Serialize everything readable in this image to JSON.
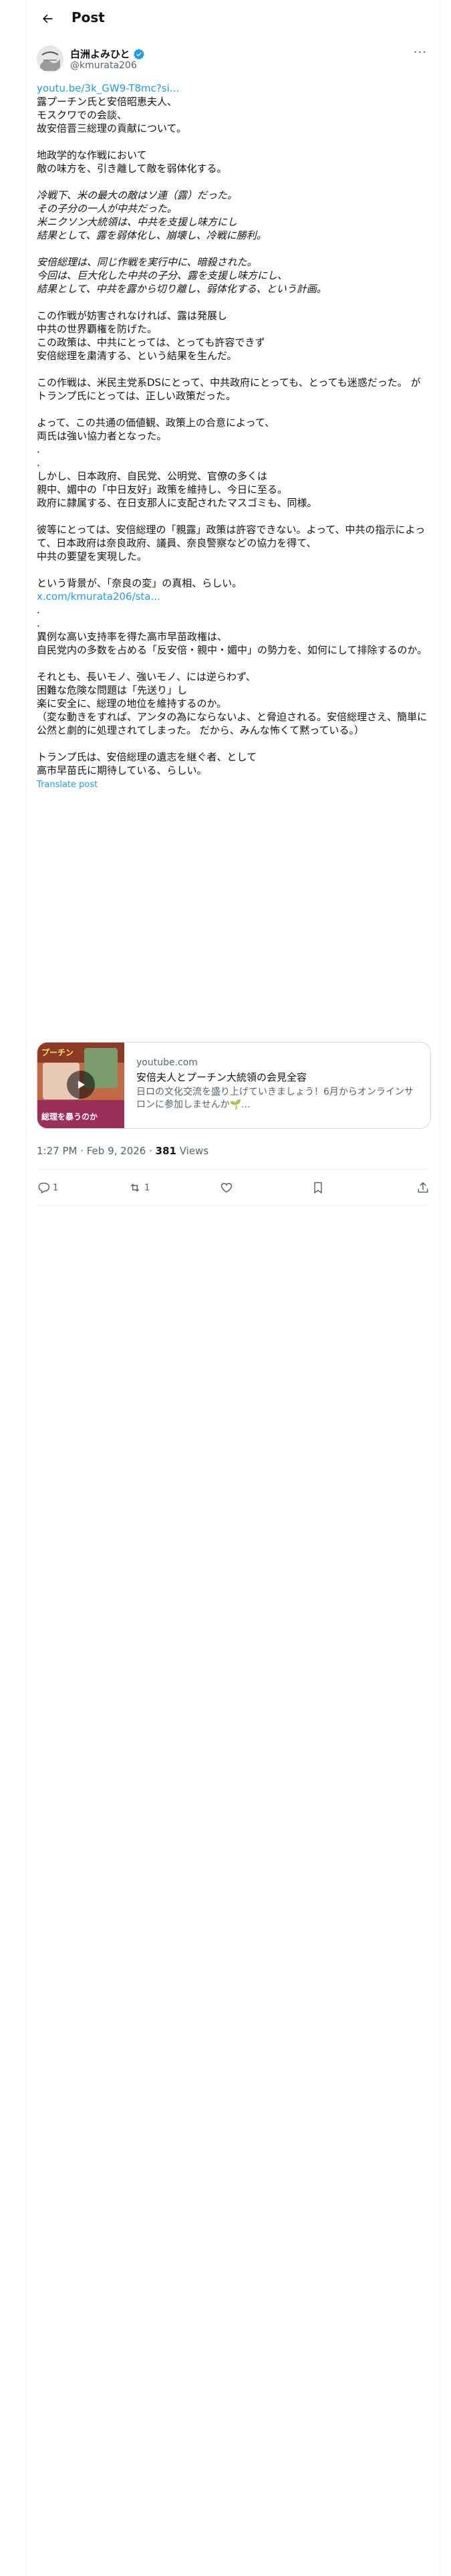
{
  "header": {
    "title": "Post"
  },
  "author": {
    "name": "白洲よみひと",
    "handle": "@kmurata206"
  },
  "post": {
    "lines": [
      {
        "t": "youtu.be/3k_GW9-T8mc?si...",
        "s": "link"
      },
      {
        "t": "露プーチン氏と安倍昭恵夫人、",
        "s": ""
      },
      {
        "t": "モスクワでの会談、",
        "s": ""
      },
      {
        "t": "故安倍晋三総理の貢献について。",
        "s": ""
      },
      {
        "t": "",
        "s": ""
      },
      {
        "t": "地政学的な作戦において",
        "s": ""
      },
      {
        "t": "敵の味方を、引き離して敵を弱体化する。",
        "s": ""
      },
      {
        "t": "",
        "s": ""
      },
      {
        "t": "冷戦下、米の最大の敵はソ連（露）だった。",
        "s": "it"
      },
      {
        "t": "その子分の一人が中共だった。",
        "s": "it"
      },
      {
        "t": "米ニクソン大統領は、中共を支援し味方にし",
        "s": "it"
      },
      {
        "t": "結果として、露を弱体化し、崩壊し、冷戦に勝利。",
        "s": "it"
      },
      {
        "t": "",
        "s": ""
      },
      {
        "t": "安倍総理は、同じ作戦を実行中に、暗殺された。",
        "s": "it"
      },
      {
        "t": "今回は、巨大化した中共の子分、露を支援し味方にし、",
        "s": "it"
      },
      {
        "t": "結果として、中共を露から切り離し、弱体化する、という計画。",
        "s": "it"
      },
      {
        "t": "",
        "s": ""
      },
      {
        "t": "この作戦が妨害されなければ、露は発展し",
        "s": ""
      },
      {
        "t": "中共の世界覇権を防げた。",
        "s": ""
      },
      {
        "t": "この政策は、中共にとっては、とっても許容できず",
        "s": ""
      },
      {
        "t": "安倍総理を粛清する、という結果を生んだ。",
        "s": ""
      },
      {
        "t": "",
        "s": ""
      },
      {
        "t": "この作戦は、米民主党系DSにとって、中共政府にとっても、とっても迷惑だった。 が",
        "s": ""
      },
      {
        "t": "トランプ氏にとっては、正しい政策だった。",
        "s": ""
      },
      {
        "t": "",
        "s": ""
      },
      {
        "t": "よって、この共通の価値観、政策上の合意によって、",
        "s": ""
      },
      {
        "t": "両氏は強い協力者となった。",
        "s": ""
      },
      {
        "t": ".",
        "s": ""
      },
      {
        "t": ".",
        "s": ""
      },
      {
        "t": "しかし、日本政府、自民党、公明党、官僚の多くは",
        "s": ""
      },
      {
        "t": "親中、媚中の「中日友好」政策を維持し、今日に至る。",
        "s": ""
      },
      {
        "t": "政府に隷属する、在日支那人に支配されたマスゴミも、同様。",
        "s": ""
      },
      {
        "t": "",
        "s": ""
      },
      {
        "t": "彼等にとっては、安倍総理の「親露」政策は許容できない。よって、中共の指示によって、日本政府は奈良政府、議員、奈良警察などの協力を得て、",
        "s": ""
      },
      {
        "t": "中共の要望を実現した。",
        "s": ""
      },
      {
        "t": "",
        "s": ""
      },
      {
        "t": "という背景が、「奈良の変」の真相、らしい。",
        "s": ""
      },
      {
        "t": "x.com/kmurata206/sta...",
        "s": "link"
      },
      {
        "t": ".",
        "s": ""
      },
      {
        "t": ".",
        "s": ""
      },
      {
        "t": "異例な高い支持率を得た高市早苗政権は、",
        "s": ""
      },
      {
        "t": "自民党内の多数を占める「反安倍・親中・媚中」の勢力を、如何にして排除するのか。",
        "s": ""
      },
      {
        "t": "",
        "s": ""
      },
      {
        "t": "それとも、長いモノ、強いモノ、には逆らわず、",
        "s": ""
      },
      {
        "t": "困難な危険な問題は「先送り」し",
        "s": ""
      },
      {
        "t": "楽に安全に、総理の地位を維持するのか。",
        "s": ""
      },
      {
        "t": "（変な動きをすれば、アンタの為にならないよ、と脅迫される。安倍総理さえ、簡単に公然と劇的に処理されてしまった。 だから、みんな怖くて黙っている。）",
        "s": ""
      },
      {
        "t": "",
        "s": ""
      },
      {
        "t": "トランプ氏は、安倍総理の遺志を継ぐ者、として",
        "s": ""
      },
      {
        "t": "高市早苗氏に期待している、らしい。",
        "s": ""
      }
    ],
    "translate_label": "Translate post"
  },
  "card": {
    "domain": "youtube.com",
    "title": "安倍夫人とプーチン大統領の会見全容",
    "description": "日ロの文化交流を盛り上げていきましょう！6月からオンラインサロンに参加しませんか🌱...",
    "thumb_caption_top": "プーチン",
    "thumb_caption_bottom": "総理を暴うのか"
  },
  "meta": {
    "time": "1:27 PM · Feb 9, 2026 · ",
    "views_count": "381",
    "views_label": " Views"
  },
  "actions": {
    "reply_count": "1",
    "repost_count": "1",
    "like_count": "",
    "bookmark_count": ""
  },
  "colors": {
    "link": "#1d9bf0",
    "verified": "#1d9bf0",
    "muted": "#536471"
  }
}
